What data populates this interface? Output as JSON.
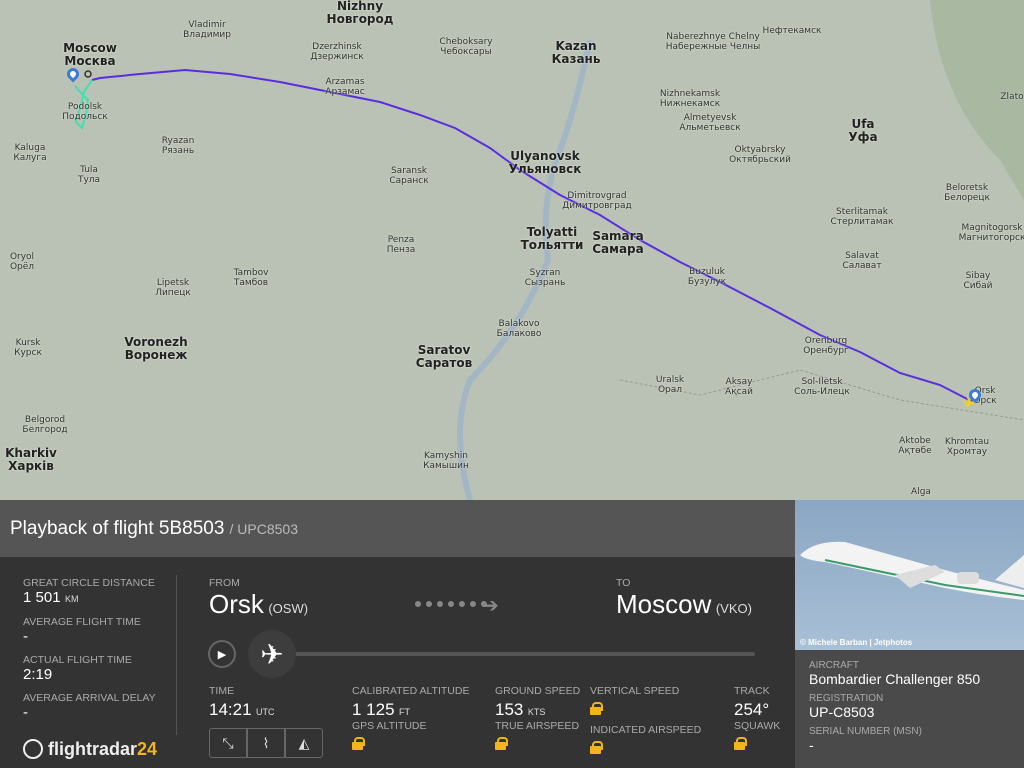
{
  "map": {
    "cities": [
      {
        "en": "Nizhny",
        "ru": "Новгород",
        "big": true
      },
      {
        "en": "Vladimir",
        "ru": "Владимир"
      },
      {
        "en": "Moscow",
        "ru": "Москва",
        "big": true
      },
      {
        "en": "Dzerzhinsk",
        "ru": "Дзержинск"
      },
      {
        "en": "Cheboksary",
        "ru": "Чебоксары"
      },
      {
        "en": "Kazan",
        "ru": "Казань",
        "big": true
      },
      {
        "en": "Naberezhnye Chelny",
        "ru": "Набережные Челны"
      },
      {
        "en": "",
        "ru": "Нефтекамск"
      },
      {
        "en": "Arzamas",
        "ru": "Арзамас"
      },
      {
        "en": "Podolsk",
        "ru": "Подольск"
      },
      {
        "en": "Nizhnekamsk",
        "ru": "Нижнекамск"
      },
      {
        "en": "Almetyevsk",
        "ru": "Альметьевск"
      },
      {
        "en": "Ufa",
        "ru": "Уфа",
        "big": true
      },
      {
        "en": "Kaluga",
        "ru": "Калуга"
      },
      {
        "en": "Ryazan",
        "ru": "Рязань"
      },
      {
        "en": "Oktyabrsky",
        "ru": "Октябрьский"
      },
      {
        "en": "Ulyanovsk",
        "ru": "Ульяновск",
        "big": true
      },
      {
        "en": "Tula",
        "ru": "Тула"
      },
      {
        "en": "Saransk",
        "ru": "Саранск"
      },
      {
        "en": "Dimitrovgrad",
        "ru": "Димитровград"
      },
      {
        "en": "Beloretsk",
        "ru": "Белорецк"
      },
      {
        "en": "Sterlitamak",
        "ru": "Стерлитамак"
      },
      {
        "en": "Magnitogorsk",
        "ru": "Магнитогорск"
      },
      {
        "en": "Tolyatti",
        "ru": "Тольятти",
        "big": true
      },
      {
        "en": "Samara",
        "ru": "Самара",
        "big": true
      },
      {
        "en": "Penza",
        "ru": "Пенза"
      },
      {
        "en": "Oryol",
        "ru": "Орёл"
      },
      {
        "en": "Salavat",
        "ru": "Салават"
      },
      {
        "en": "Buzuluk",
        "ru": "Бузулук"
      },
      {
        "en": "Sibay",
        "ru": "Сибай"
      },
      {
        "en": "Lipetsk",
        "ru": "Липецк"
      },
      {
        "en": "Tambov",
        "ru": "Тамбов"
      },
      {
        "en": "Syzran",
        "ru": "Сызрань"
      },
      {
        "en": "Voronezh",
        "ru": "Воронеж",
        "big": true
      },
      {
        "en": "Kursk",
        "ru": "Курск"
      },
      {
        "en": "Balakovo",
        "ru": "Балаково"
      },
      {
        "en": "Orenburg",
        "ru": "Оренбург"
      },
      {
        "en": "Saratov",
        "ru": "Саратов",
        "big": true
      },
      {
        "en": "Uralsk",
        "ru": "Орал"
      },
      {
        "en": "Aksay",
        "ru": "Ақсай"
      },
      {
        "en": "Sol-Iletsk",
        "ru": "Соль-Илецк"
      },
      {
        "en": "Orsk",
        "ru": "Орск"
      },
      {
        "en": "Belgorod",
        "ru": "Белгород"
      },
      {
        "en": "Aktobe",
        "ru": "Ақтөбе"
      },
      {
        "en": "Khromtau",
        "ru": "Хромтау"
      },
      {
        "en": "Kharkiv",
        "ru": "Харків",
        "big": true
      },
      {
        "en": "Kamyshin",
        "ru": "Камышин"
      },
      {
        "en": "Alga",
        "ru": ""
      },
      {
        "en": "Zlato",
        "ru": ""
      }
    ],
    "track_color": "#5a2ee0"
  },
  "header": {
    "title": "Playback of flight 5B8503",
    "callsign": "/ UPC8503"
  },
  "stats": {
    "gcd_label": "Great circle distance",
    "gcd_value": "1 501",
    "gcd_unit": "km",
    "aft_label": "Average flight time",
    "aft_value": "-",
    "act_label": "Actual flight time",
    "act_value": "2:19",
    "aad_label": "Average arrival delay",
    "aad_value": "-"
  },
  "route": {
    "from_label": "FROM",
    "from_city": "Orsk",
    "from_code": "(OSW)",
    "to_label": "TO",
    "to_city": "Moscow",
    "to_code": "(VKO)"
  },
  "playback": {
    "progress": 0.0
  },
  "data": {
    "time_label": "TIME",
    "time_value": "14:21",
    "time_unit": "UTC",
    "calt_label": "Calibrated altitude",
    "calt_value": "1 125",
    "calt_unit": "FT",
    "gps_label": "GPS altitude",
    "gs_label": "Ground speed",
    "gs_value": "153",
    "gs_unit": "KTS",
    "tas_label": "True airspeed",
    "vs_label": "Vertical speed",
    "ias_label": "Indicated airspeed",
    "track_label": "Track",
    "track_value": "254°",
    "squawk_label": "Squawk"
  },
  "logo": {
    "text": "flightradar",
    "num": "24"
  },
  "aircraft": {
    "photo_credit": "© Michele Barban | Jetphotos",
    "aircraft_label": "AIRCRAFT",
    "aircraft_value": "Bombardier Challenger 850",
    "reg_label": "REGISTRATION",
    "reg_value": "UP-C8503",
    "msn_label": "SERIAL NUMBER (MSN)",
    "msn_value": "-"
  },
  "colors": {
    "accent": "#f2b51c",
    "panel": "#333333"
  }
}
